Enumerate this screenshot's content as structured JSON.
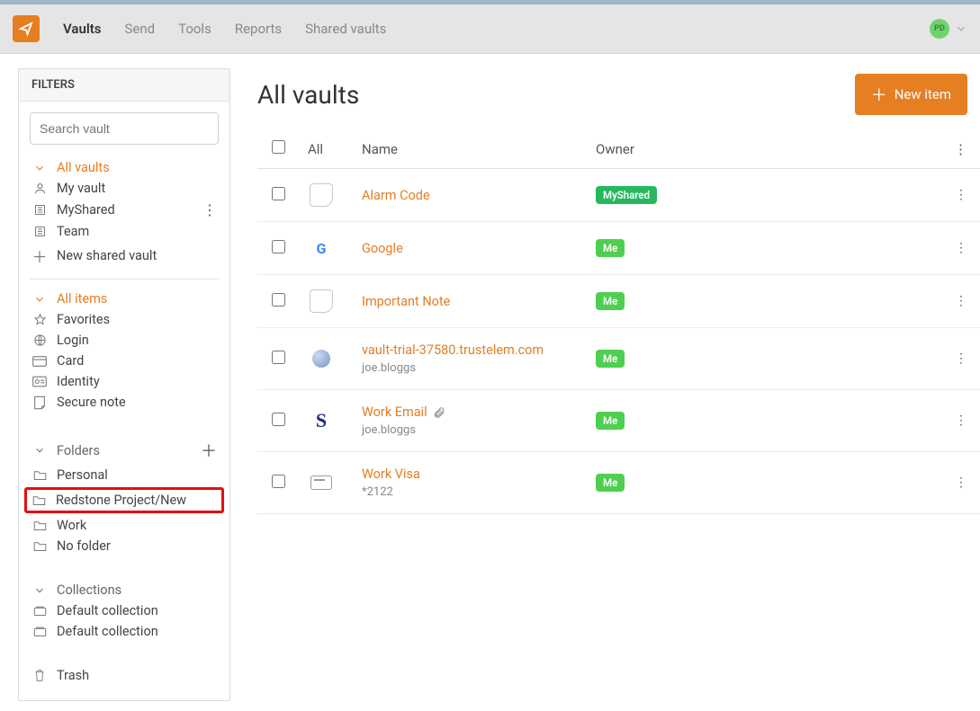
{
  "nav": {
    "items": [
      "Vaults",
      "Send",
      "Tools",
      "Reports",
      "Shared vaults"
    ],
    "active": 0
  },
  "user": {
    "initials": "PD"
  },
  "sidebar": {
    "title": "FILTERS",
    "search_placeholder": "Search vault",
    "vaults_header": "All vaults",
    "vault_items": [
      {
        "label": "My vault",
        "icon": "person-icon"
      },
      {
        "label": "MyShared",
        "icon": "org-icon",
        "more": true
      },
      {
        "label": "Team",
        "icon": "org-icon"
      },
      {
        "label": "New shared vault",
        "icon": "plus-icon"
      }
    ],
    "items_header": "All items",
    "type_items": [
      {
        "label": "Favorites",
        "icon": "star-icon"
      },
      {
        "label": "Login",
        "icon": "globe-icon"
      },
      {
        "label": "Card",
        "icon": "card-icon"
      },
      {
        "label": "Identity",
        "icon": "id-icon"
      },
      {
        "label": "Secure note",
        "icon": "note-icon"
      }
    ],
    "folders_header": "Folders",
    "folders": [
      {
        "label": "Personal"
      },
      {
        "label": "Redstone Project/New",
        "highlight": true
      },
      {
        "label": "Work"
      },
      {
        "label": "No folder"
      }
    ],
    "collections_header": "Collections",
    "collections": [
      {
        "label": "Default collection"
      },
      {
        "label": "Default collection"
      }
    ],
    "trash": "Trash"
  },
  "main": {
    "title": "All vaults",
    "new_button": "New item",
    "columns": {
      "all": "All",
      "name": "Name",
      "owner": "Owner"
    },
    "rows": [
      {
        "icon": "note",
        "name": "Alarm Code",
        "owner_type": "shared",
        "owner": "MyShared"
      },
      {
        "icon": "google",
        "name": "Google",
        "owner_type": "me",
        "owner": "Me"
      },
      {
        "icon": "note",
        "name": "Important Note",
        "owner_type": "me",
        "owner": "Me"
      },
      {
        "icon": "globe",
        "name": "vault-trial-37580.trustelem.com",
        "sub": "joe.bloggs",
        "owner_type": "me",
        "owner": "Me"
      },
      {
        "icon": "s",
        "name": "Work Email",
        "sub": "joe.bloggs",
        "attachment": true,
        "owner_type": "me",
        "owner": "Me"
      },
      {
        "icon": "card",
        "name": "Work Visa",
        "sub": "*2122",
        "owner_type": "me",
        "owner": "Me"
      }
    ]
  }
}
